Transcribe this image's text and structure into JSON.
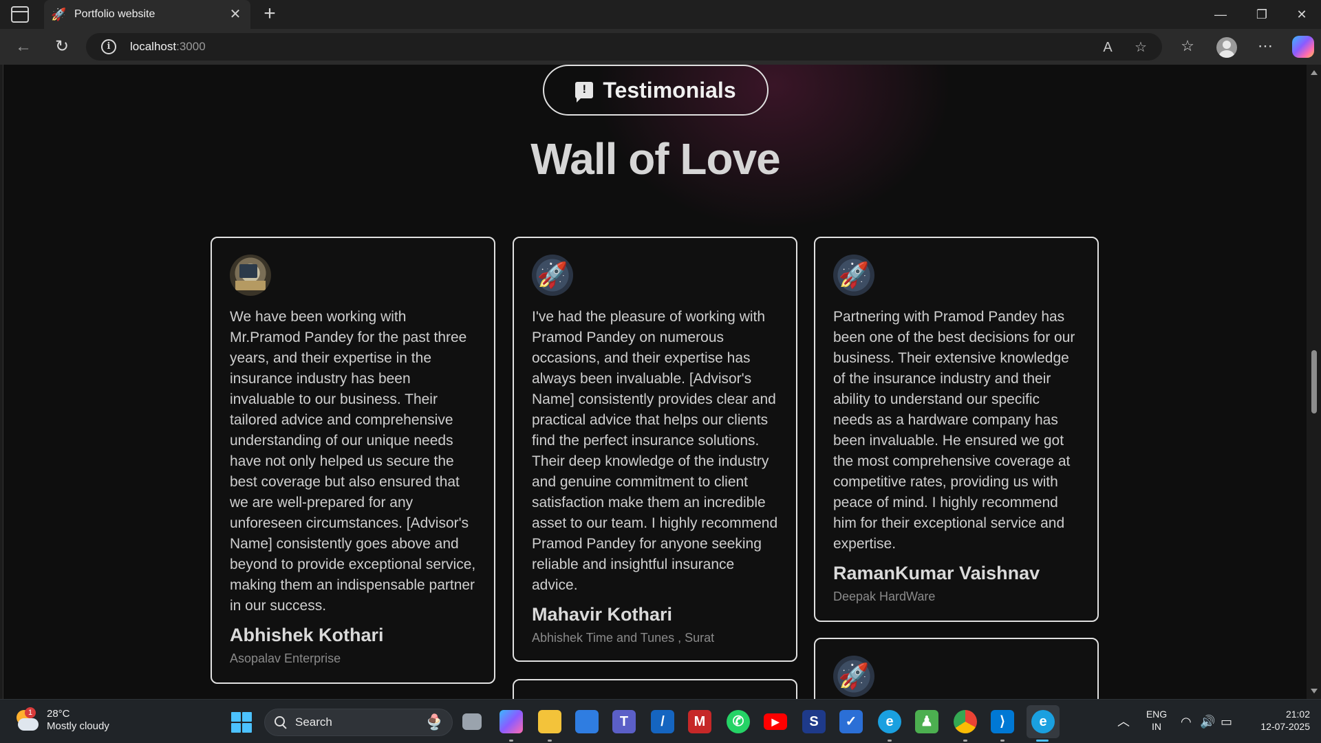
{
  "browser": {
    "tab_title": "Portfolio website",
    "url_host": "localhost",
    "url_port": ":3000"
  },
  "page": {
    "pill_label": "Testimonials",
    "title": "Wall of Love",
    "testimonials": [
      {
        "avatar": "photo",
        "text": "We have been working with Mr.Pramod Pandey for the past three years, and their expertise in the insurance industry has been invaluable to our business. Their tailored advice and comprehensive understanding of our unique needs have not only helped us secure the best coverage but also ensured that we are well-prepared for any unforeseen circumstances. [Advisor's Name] consistently goes above and beyond to provide exceptional service, making them an indispensable partner in our success.",
        "name": "Abhishek Kothari",
        "company": "Asopalav Enterprise"
      },
      {
        "avatar": "rocket",
        "text": "I've had the pleasure of working with Pramod Pandey on numerous occasions, and their expertise has always been invaluable. [Advisor's Name] consistently provides clear and practical advice that helps our clients find the perfect insurance solutions. Their deep knowledge of the industry and genuine commitment to client satisfaction make them an incredible asset to our team. I highly recommend Pramod Pandey for anyone seeking reliable and insightful insurance advice.",
        "name": "Mahavir Kothari",
        "company": "Abhishek Time and Tunes , Surat"
      },
      {
        "avatar": "rocket",
        "text": "Partnering with Pramod Pandey has been one of the best decisions for our business. Their extensive knowledge of the insurance industry and their ability to understand our specific needs as a hardware company has been invaluable. He ensured we got the most comprehensive coverage at competitive rates, providing us with peace of mind. I highly recommend him for their exceptional service and expertise.",
        "name": "RamanKumar Vaishnav",
        "company": "Deepak HardWare"
      }
    ]
  },
  "taskbar": {
    "weather_temp": "28°C",
    "weather_desc": "Mostly cloudy",
    "weather_badge": "1",
    "search_label": "Search",
    "lang_top": "ENG",
    "lang_bottom": "IN",
    "time": "21:02",
    "date": "12-07-2025"
  },
  "colors": {
    "page_bg": "#0e0e0e",
    "card_border": "#e2e2e2",
    "accent_glow": "#6e1e46"
  }
}
